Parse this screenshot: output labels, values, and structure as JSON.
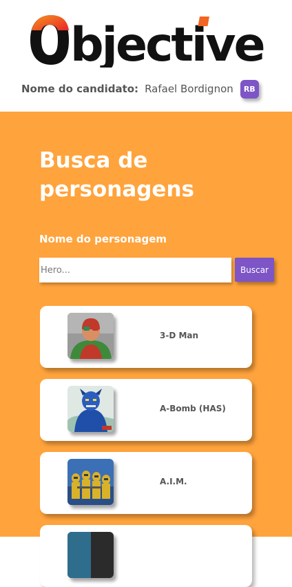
{
  "header": {
    "logo_text": "Objective",
    "candidate_label": "Nome do candidato:",
    "candidate_name": "Rafael Bordignon",
    "avatar_initials": "RB"
  },
  "search": {
    "title": "Busca de personagens",
    "field_label": "Nome do personagem",
    "placeholder": "Hero...",
    "value": "",
    "button_label": "Buscar"
  },
  "characters": [
    {
      "name": "3-D Man",
      "thumbnail_icon": "character-portrait"
    },
    {
      "name": "A-Bomb (HAS)",
      "thumbnail_icon": "character-portrait"
    },
    {
      "name": "A.I.M.",
      "thumbnail_icon": "character-portrait"
    },
    {
      "name": "",
      "thumbnail_icon": "character-portrait"
    }
  ],
  "colors": {
    "brand_orange": "#ffa33c",
    "logo_orange": "#f26522",
    "accent_purple": "#7d55c7",
    "text_gray": "#555555"
  }
}
